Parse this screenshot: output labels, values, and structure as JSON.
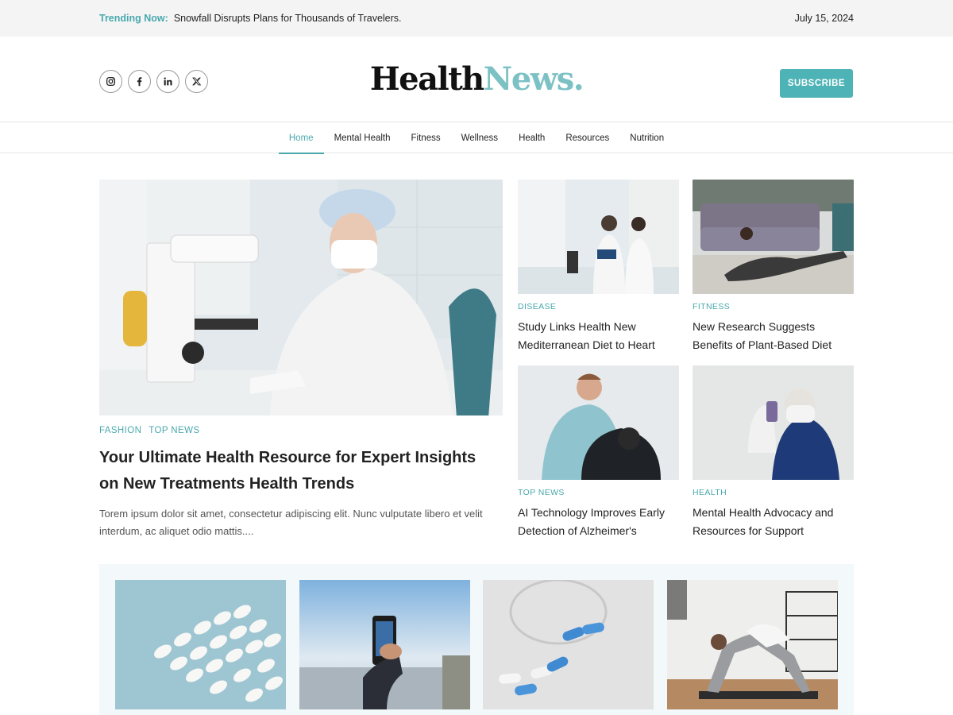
{
  "topbar": {
    "trending_label": "Trending Now:",
    "trending_text": "Snowfall Disrupts Plans for Thousands of Travelers.",
    "date": "July 15, 2024"
  },
  "header": {
    "logo_part1": "Health",
    "logo_part2": "News.",
    "subscribe_label": "SUBSCRIBE",
    "social_icons": [
      "instagram-icon",
      "facebook-icon",
      "linkedin-icon",
      "x-icon"
    ]
  },
  "nav": {
    "items": [
      {
        "label": "Home",
        "active": true
      },
      {
        "label": "Mental Health"
      },
      {
        "label": "Fitness"
      },
      {
        "label": "Wellness"
      },
      {
        "label": "Health"
      },
      {
        "label": "Resources"
      },
      {
        "label": "Nutrition"
      }
    ]
  },
  "feature": {
    "tags": [
      "FASHION",
      "TOP NEWS"
    ],
    "title": "Your Ultimate Health Resource for Expert Insights on New Treatments Health Trends",
    "excerpt": "Torem ipsum dolor sit amet, consectetur adipiscing elit. Nunc vulputate libero et velit interdum, ac aliquet odio mattis...."
  },
  "cards": [
    {
      "category": "DISEASE",
      "title": "Study Links Health New Mediterranean Diet to Heart"
    },
    {
      "category": "FITNESS",
      "title": "New Research Suggests Benefits of Plant-Based Diet"
    },
    {
      "category": "TOP NEWS",
      "title": "AI Technology Improves Early Detection of Alzheimer's"
    },
    {
      "category": "HEALTH",
      "title": "Mental Health Advocacy and Resources for Support"
    }
  ],
  "colors": {
    "accent": "#4eb3b6",
    "accent_text": "#4aa8ac",
    "logo_accent": "#7cc1c4",
    "topbar_bg": "#f4f4f4",
    "strip_bg": "#f3f8fa"
  }
}
